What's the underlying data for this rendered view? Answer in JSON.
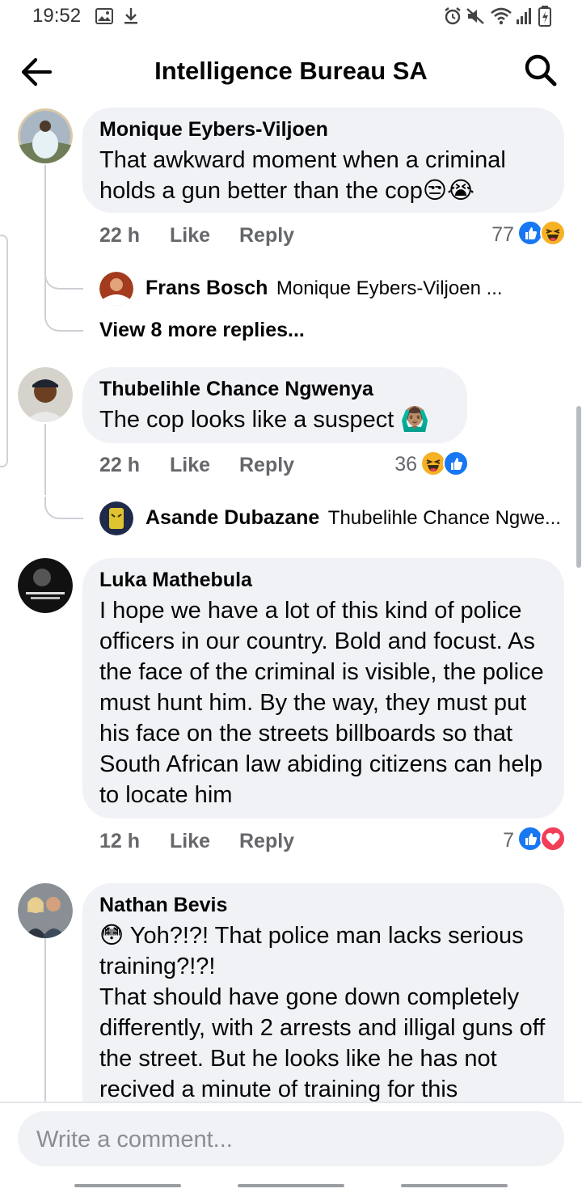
{
  "status_bar": {
    "time": "19:52"
  },
  "header": {
    "title": "Intelligence Bureau SA"
  },
  "comments": [
    {
      "author": "Monique Eybers-Viljoen",
      "text": "That awkward moment when a criminal holds a gun better than the cop😒😭",
      "time": "22 h",
      "like": "Like",
      "reply": "Reply",
      "reactions_count": "77",
      "reply_preview": {
        "name": "Frans Bosch",
        "text": "Monique Eybers-Viljoen ..."
      },
      "more_replies": "View 8 more replies..."
    },
    {
      "author": "Thubelihle Chance Ngwenya",
      "text": "The cop looks like a suspect 🙆🏽‍♂️",
      "time": "22 h",
      "like": "Like",
      "reply": "Reply",
      "reactions_count": "36",
      "reply_preview": {
        "name": "Asande Dubazane",
        "text": "Thubelihle Chance Ngwe..."
      }
    },
    {
      "author": "Luka Mathebula",
      "text": "I hope we have a lot of this kind of police officers in our country. Bold and focust. As the face of the criminal is visible, the police must hunt him. By the way, they must put his face on the streets billboards so that South African law abiding citizens can help to locate him",
      "time": "12 h",
      "like": "Like",
      "reply": "Reply",
      "reactions_count": "7"
    },
    {
      "author": "Nathan Bevis",
      "text": "😳 Yoh?!?! That police man lacks serious training?!?!\nThat should have gone down completely differently, with 2 arrests and illigal guns off the street. But he looks like he has not recived a minute of training for this"
    }
  ],
  "composer": {
    "placeholder": "Write a comment..."
  },
  "colors": {
    "bubble": "#f0f2f5",
    "muted_text": "#65676b",
    "like_blue": "#1877f2",
    "haha_yellow": "#f7b125",
    "love_red": "#f33e58"
  },
  "icons": [
    "back-arrow-icon",
    "search-icon",
    "like-reaction-icon",
    "haha-reaction-icon",
    "love-reaction-icon"
  ]
}
